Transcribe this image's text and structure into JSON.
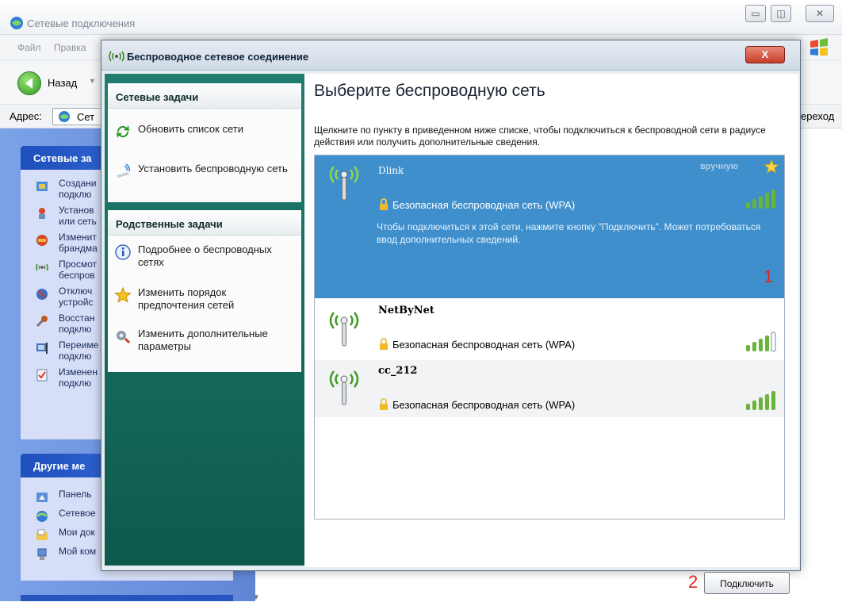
{
  "bg_window": {
    "title": "Сетевые подключения",
    "menu": [
      "Файл",
      "Правка"
    ],
    "back_label": "Назад",
    "address_label": "Адрес:",
    "address_value": "Сет",
    "go_label": "ереход",
    "panels": [
      {
        "title": "Сетевые за",
        "items": [
          {
            "icon": "new-connection-icon",
            "lines": [
              "Создани",
              "подклю"
            ]
          },
          {
            "icon": "setup-network-icon",
            "lines": [
              "Установ",
              "или сеть"
            ]
          },
          {
            "icon": "firewall-icon",
            "lines": [
              "Изменит",
              "брандма"
            ]
          },
          {
            "icon": "wireless-icon",
            "lines": [
              "Просмот",
              "беспров"
            ]
          },
          {
            "icon": "disable-device-icon",
            "lines": [
              "Отключ",
              "устройс"
            ]
          },
          {
            "icon": "repair-icon",
            "lines": [
              "Восстан",
              "подклю"
            ]
          },
          {
            "icon": "rename-icon",
            "lines": [
              "Переиме",
              "подклю"
            ]
          },
          {
            "icon": "properties-icon",
            "lines": [
              "Изменен",
              "подклю"
            ]
          }
        ]
      },
      {
        "title": "Другие ме",
        "items": [
          {
            "icon": "control-panel-icon",
            "lines": [
              "Панель"
            ]
          },
          {
            "icon": "network-places-icon",
            "lines": [
              "Сетевое"
            ]
          },
          {
            "icon": "my-documents-icon",
            "lines": [
              "Мои док"
            ]
          },
          {
            "icon": "my-computer-icon",
            "lines": [
              "Мой ком"
            ]
          }
        ]
      }
    ]
  },
  "dialog": {
    "title": "Беспроводное сетевое соединение",
    "close_label": "X",
    "left_pane": {
      "network_tasks": {
        "title": "Сетевые задачи",
        "items": [
          {
            "icon": "refresh-icon",
            "label": "Обновить список сети"
          },
          {
            "icon": "wireless-setup-icon",
            "label": "Установить беспроводную сеть"
          }
        ]
      },
      "related_tasks": {
        "title": "Родственные задачи",
        "items": [
          {
            "icon": "info-icon",
            "label": "Подробнее о беспроводных сетях"
          },
          {
            "icon": "star-icon",
            "label": "Изменить порядок предпочтения сетей"
          },
          {
            "icon": "advanced-settings-icon",
            "label": "Изменить дополнительные параметры"
          }
        ]
      }
    },
    "heading": "Выберите беспроводную сеть",
    "description": "Щелкните по пункту в приведенном ниже списке, чтобы подключиться к беспроводной сети в радиусе действия или получить дополнительные сведения.",
    "networks": [
      {
        "name": "Dlink",
        "security": "Безопасная беспроводная сеть (WPA)",
        "selected": true,
        "manual_label": "вручную",
        "hint": "Чтобы подключиться к этой сети, нажмите кнопку \"Подключить\". Может потребоваться ввод дополнительных сведений.",
        "marker": "1",
        "signal_bars": 5
      },
      {
        "name": "NetByNet",
        "security": "Безопасная беспроводная сеть (WPA)",
        "selected": false,
        "signal_bars": 4
      },
      {
        "name": "cc_212",
        "security": "Безопасная беспроводная сеть (WPA)",
        "selected": false,
        "signal_bars": 5
      }
    ],
    "connect_marker": "2",
    "connect_label": "Подключить"
  },
  "colors": {
    "selected_row": "#3e8fcc",
    "left_pane": "#0d5a4d",
    "marker": "#e6241c",
    "signal_green": "#6ab43a"
  }
}
